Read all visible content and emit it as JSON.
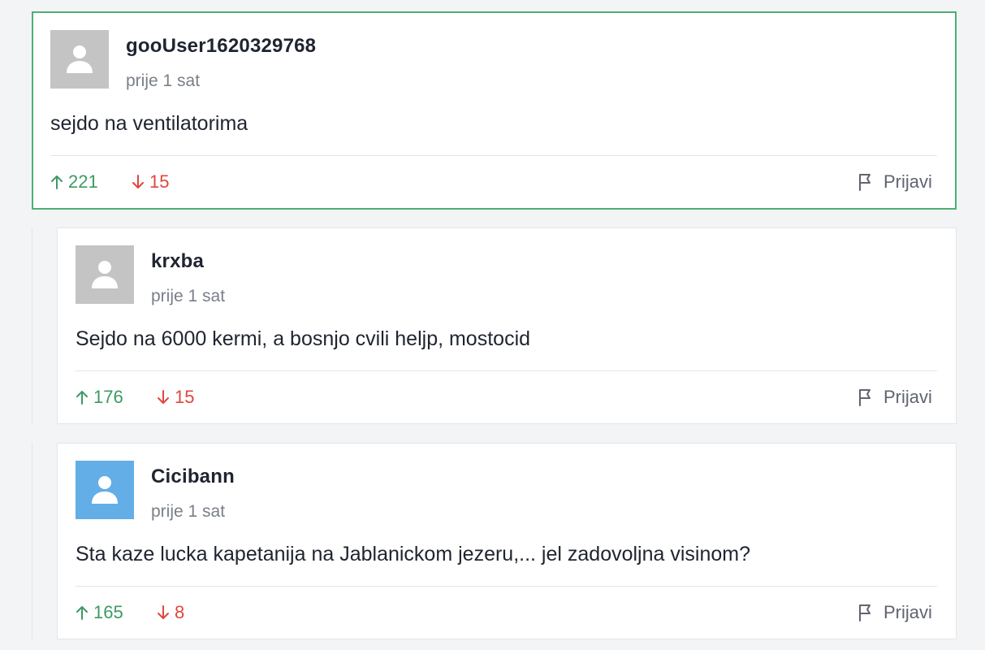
{
  "colors": {
    "upvote": "#3d9a62",
    "downvote": "#e0463e",
    "highlight_border": "#4caf72",
    "avatar_gray": "#c4c4c4",
    "avatar_blue": "#63aee6"
  },
  "comments": [
    {
      "username": "gooUser1620329768",
      "time": "prije 1 sat",
      "text": "sejdo na ventilatorima",
      "upvotes": "221",
      "downvotes": "15",
      "report_label": "Prijavi",
      "avatar_icon": "user-icon"
    },
    {
      "username": "krxba",
      "time": "prije 1 sat",
      "text": "Sejdo na 6000 kermi, a bosnjo cvili heljp, mostocid",
      "upvotes": "176",
      "downvotes": "15",
      "report_label": "Prijavi",
      "avatar_icon": "user-icon"
    },
    {
      "username": "Cicibann",
      "time": "prije 1 sat",
      "text": "Sta kaze lucka kapetanija na Jablanickom jezeru,... jel zadovoljna visinom?",
      "upvotes": "165",
      "downvotes": "8",
      "report_label": "Prijavi",
      "avatar_icon": "user-icon"
    }
  ]
}
